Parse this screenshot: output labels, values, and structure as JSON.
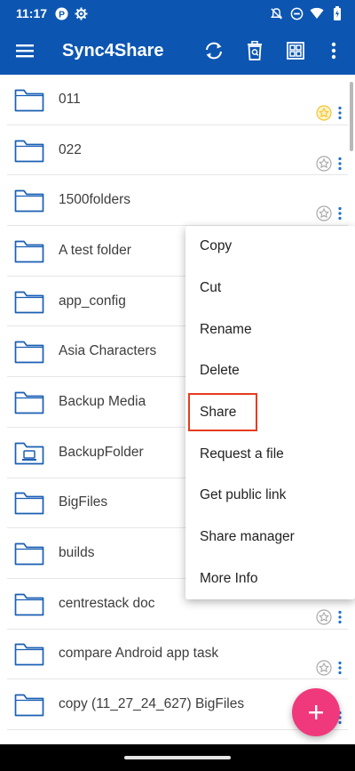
{
  "status_bar": {
    "time": "11:17",
    "left_icons": [
      "p-badge-icon",
      "settings-gear-icon"
    ],
    "right_icons": [
      "mute-icon",
      "do-not-disturb-icon",
      "wifi-icon",
      "battery-icon"
    ]
  },
  "app_bar": {
    "title": "Sync4Share",
    "icons": [
      "menu-icon",
      "sync-icon",
      "trash-icon",
      "grid-view-icon",
      "more-vert-icon"
    ]
  },
  "files": [
    {
      "name": "011",
      "icon": "folder-icon",
      "starred": true
    },
    {
      "name": "022",
      "icon": "folder-icon",
      "starred": false
    },
    {
      "name": "1500folders",
      "icon": "folder-icon",
      "starred": false
    },
    {
      "name": "A test folder",
      "icon": "folder-icon",
      "starred": false
    },
    {
      "name": "app_config",
      "icon": "folder-icon",
      "starred": false
    },
    {
      "name": "Asia Characters",
      "icon": "folder-icon",
      "starred": false
    },
    {
      "name": "Backup Media",
      "icon": "folder-icon",
      "starred": false
    },
    {
      "name": "BackupFolder",
      "icon": "computer-folder-icon",
      "starred": false
    },
    {
      "name": "BigFiles",
      "icon": "folder-icon",
      "starred": false
    },
    {
      "name": "builds",
      "icon": "folder-icon",
      "starred": false
    },
    {
      "name": "centrestack doc",
      "icon": "folder-icon",
      "starred": false
    },
    {
      "name": "compare Android app task",
      "icon": "folder-icon",
      "starred": false
    },
    {
      "name": "copy (11_27_24_627) BigFiles",
      "icon": "folder-icon",
      "starred": false
    }
  ],
  "context_menu": {
    "items": [
      "Copy",
      "Cut",
      "Rename",
      "Delete",
      "Share",
      "Request a file",
      "Get public link",
      "Share manager",
      "More Info"
    ],
    "highlighted": "Share"
  },
  "fab": {
    "icon": "plus-icon"
  },
  "colors": {
    "primary": "#0c56b2",
    "fab": "#f0397c",
    "folder_outline": "#1a5fb4",
    "star_active": "#f4c430",
    "highlight_box": "#e53c1e"
  }
}
